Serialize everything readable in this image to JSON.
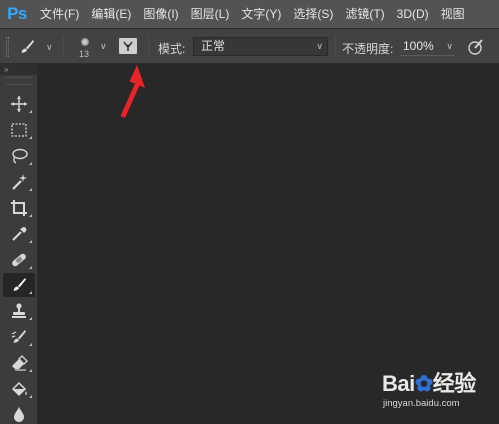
{
  "app": {
    "logo": "Ps"
  },
  "menu": {
    "items": [
      "文件(F)",
      "编辑(E)",
      "图像(I)",
      "图层(L)",
      "文字(Y)",
      "选择(S)",
      "滤镜(T)",
      "3D(D)",
      "视图"
    ]
  },
  "options": {
    "brush_size": "13",
    "mode_label": "模式:",
    "mode_value": "正常",
    "opacity_label": "不透明度:",
    "opacity_value": "100%"
  },
  "toolbar": {
    "header": "»",
    "tools": [
      {
        "name": "move-tool",
        "icon": "move-icon"
      },
      {
        "name": "marquee-tool",
        "icon": "rect-marquee-icon"
      },
      {
        "name": "lasso-tool",
        "icon": "lasso-icon"
      },
      {
        "name": "magic-wand-tool",
        "icon": "magic-wand-icon"
      },
      {
        "name": "crop-tool",
        "icon": "crop-icon"
      },
      {
        "name": "eyedropper-tool",
        "icon": "eyedropper-icon"
      },
      {
        "name": "healing-brush-tool",
        "icon": "bandage-icon"
      },
      {
        "name": "brush-tool",
        "icon": "brush-icon",
        "active": true
      },
      {
        "name": "clone-stamp-tool",
        "icon": "stamp-icon"
      },
      {
        "name": "history-brush-tool",
        "icon": "history-brush-icon"
      },
      {
        "name": "eraser-tool",
        "icon": "eraser-icon"
      },
      {
        "name": "paint-bucket-tool",
        "icon": "paint-bucket-icon"
      },
      {
        "name": "blur-tool",
        "icon": "drop-icon"
      }
    ]
  },
  "annotation": {
    "color": "#e8232a"
  },
  "watermark": {
    "logo_a": "Bai",
    "logo_b": "经验",
    "url": "jingyan.baidu.com"
  },
  "colors": {
    "menubar": "#535353",
    "optionsbar": "#424242",
    "toolbar": "#3c3c3c",
    "workspace": "#282828",
    "ps_blue": "#31a8ff"
  }
}
